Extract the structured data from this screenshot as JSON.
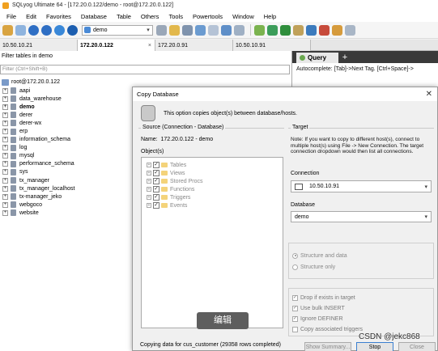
{
  "window": {
    "title": "SQLyog Ultimate 64 - [172.20.0.122/demo - root@172.20.0.122]"
  },
  "menu": [
    "File",
    "Edit",
    "Favorites",
    "Database",
    "Table",
    "Others",
    "Tools",
    "Powertools",
    "Window",
    "Help"
  ],
  "toolbar": {
    "db_select_value": "demo"
  },
  "tabs": [
    {
      "label": "10.50.10.21",
      "active": false
    },
    {
      "label": "172.20.0.122",
      "active": true
    },
    {
      "label": "172.20.0.91",
      "active": false
    },
    {
      "label": "10.50.10.91",
      "active": false
    }
  ],
  "object_browser": {
    "filter_label": "Filter tables in demo",
    "filter_placeholder": "Filter (Ctrl+Shift+B)",
    "root": "root@172.20.0.122",
    "databases": [
      "aapi",
      "data_warehouse",
      "demo",
      "derer",
      "derer-wx",
      "erp",
      "information_schema",
      "log",
      "mysql",
      "performance_schema",
      "sys",
      "tx_manager",
      "tx_manager_localhost",
      "tx-manager_jeko",
      "webgoco",
      "website"
    ],
    "selected_database": "demo"
  },
  "query": {
    "tab_label": "Query",
    "add_tab": "+",
    "autocomplete_text": "Autocomplete: [Tab]->Next Tag. [Ctrl+Space]->"
  },
  "dialog": {
    "title": "Copy Database",
    "close": "✕",
    "description": "This option copies object(s) between database/hosts.",
    "source": {
      "group_label": "Source (Connection - Database)",
      "name_label": "Name:",
      "name_value": "172.20.0.122 - demo",
      "objects_label": "Object(s)",
      "objects": [
        "Tables",
        "Views",
        "Stored Procs",
        "Functions",
        "Triggers",
        "Events"
      ]
    },
    "target": {
      "group_label": "Target",
      "note": "Note: If you want to copy to different host(s), connect to multiple host(s) using File -> New Connection. The target connection dropdown would then list all connections.",
      "connection_label": "Connection",
      "connection_value": "10.50.10.91",
      "database_label": "Database",
      "database_value": "demo"
    },
    "options": {
      "structure_and_data": "Structure and data",
      "structure_only": "Structure only",
      "selected": "structure_and_data"
    },
    "checkboxes": [
      {
        "label": "Drop if exists in target",
        "checked": true
      },
      {
        "label": "Use bulk INSERT",
        "checked": true
      },
      {
        "label": "Ignore DEFINER",
        "checked": true
      },
      {
        "label": "Copy associated triggers",
        "checked": false
      }
    ],
    "status": "Copying data for cus_customer (29358 rows completed)",
    "buttons": {
      "show_summary": "Show Summary...",
      "stop": "Stop",
      "close": "Close"
    }
  },
  "overlay": {
    "edit_badge": "编辑",
    "csdn_watermark": "CSDN @jekc868"
  }
}
